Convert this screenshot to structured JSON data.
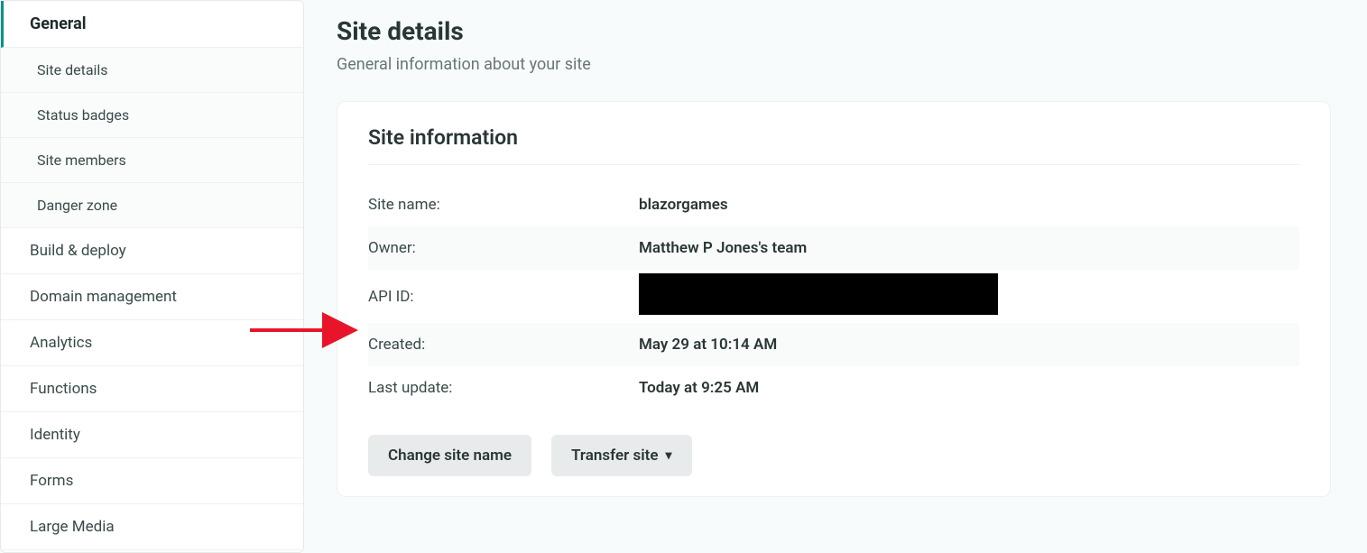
{
  "sidebar": {
    "items": [
      {
        "label": "General",
        "active": true,
        "children": [
          {
            "label": "Site details"
          },
          {
            "label": "Status badges"
          },
          {
            "label": "Site members"
          },
          {
            "label": "Danger zone"
          }
        ]
      },
      {
        "label": "Build & deploy"
      },
      {
        "label": "Domain management"
      },
      {
        "label": "Analytics"
      },
      {
        "label": "Functions"
      },
      {
        "label": "Identity"
      },
      {
        "label": "Forms"
      },
      {
        "label": "Large Media"
      }
    ]
  },
  "page": {
    "title": "Site details",
    "subtitle": "General information about your site"
  },
  "card": {
    "title": "Site information",
    "rows": [
      {
        "label": "Site name:",
        "value": "blazorgames"
      },
      {
        "label": "Owner:",
        "value": "Matthew P Jones's team"
      },
      {
        "label": "API ID:",
        "value": ""
      },
      {
        "label": "Created:",
        "value": "May 29 at 10:14 AM"
      },
      {
        "label": "Last update:",
        "value": "Today at 9:25 AM"
      }
    ],
    "buttons": {
      "change_name": "Change site name",
      "transfer": "Transfer site"
    }
  }
}
